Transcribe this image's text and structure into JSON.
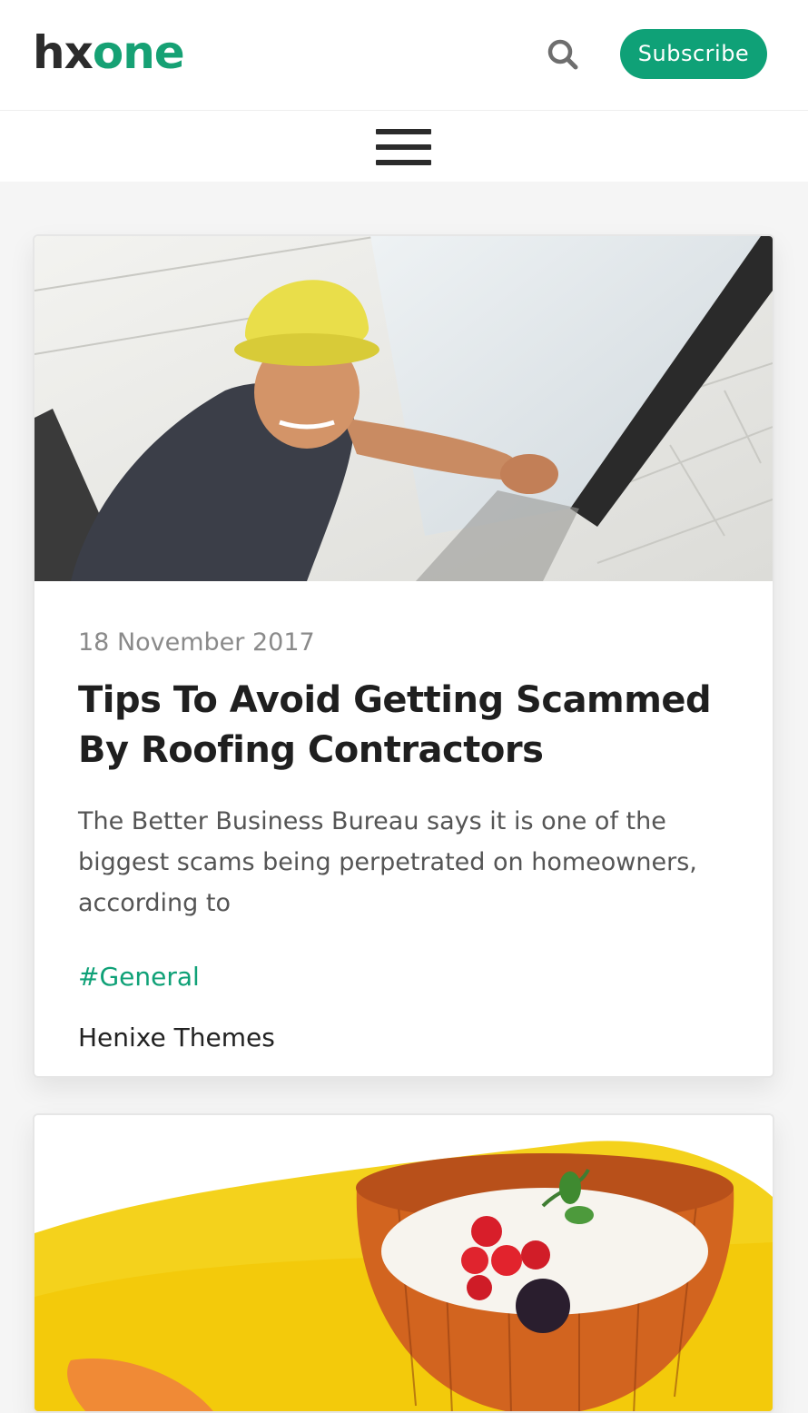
{
  "header": {
    "logo": {
      "part1": "hx",
      "part2": "one"
    },
    "search_icon": "search-icon",
    "subscribe_label": "Subscribe",
    "menu_icon": "hamburger-menu-icon"
  },
  "colors": {
    "accent": "#0fa177",
    "logo_dark": "#2b2b2b",
    "background": "#f5f5f5"
  },
  "posts": [
    {
      "image": "roofer-in-yellow-hard-hat-on-roof-with-skylight",
      "date": "18 November 2017",
      "title": "Tips To Avoid Getting Scammed By Roofing Contractors",
      "excerpt": "The Better Business Bureau says it is one of the biggest scams being perpetrated on homeowners, according to",
      "tag": "#General",
      "author": "Henixe Themes"
    },
    {
      "image": "wooden-bowl-of-yogurt-with-berries-on-yellow-cloth"
    }
  ]
}
